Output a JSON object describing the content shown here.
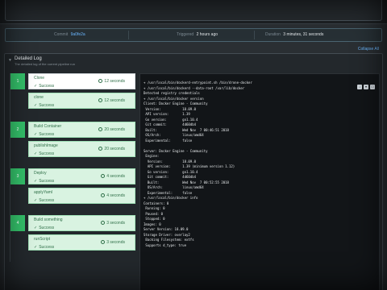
{
  "build_info": {
    "commit_label": "Commit",
    "commit_value": "9a0fe2a",
    "triggered_label": "Triggered",
    "triggered_value": "2 hours ago",
    "duration_label": "Duration",
    "duration_value": "3 minutes, 31 seconds"
  },
  "collapse_all": "Collapse All",
  "panel": {
    "title": "Detailed Log",
    "subtitle": "The detailed log of the current pipeline run"
  },
  "groups": [
    {
      "number": "1",
      "steps": [
        {
          "name": "Clone",
          "status": "Success",
          "duration": "12 seconds",
          "active": true
        },
        {
          "name": "clone",
          "status": "Success",
          "duration": "12 seconds",
          "active": false
        }
      ]
    },
    {
      "number": "2",
      "steps": [
        {
          "name": "Build Container",
          "status": "Success",
          "duration": "20 seconds",
          "active": false
        },
        {
          "name": "publishImage",
          "status": "Success",
          "duration": "20 seconds",
          "active": false
        }
      ]
    },
    {
      "number": "3",
      "steps": [
        {
          "name": "Deploy",
          "status": "Success",
          "duration": "4 seconds",
          "active": false
        },
        {
          "name": "applyYaml",
          "status": "Success",
          "duration": "4 seconds",
          "active": false
        }
      ]
    },
    {
      "number": "4",
      "steps": [
        {
          "name": "Build something",
          "status": "Success",
          "duration": "3 seconds",
          "active": false
        },
        {
          "name": "runScript",
          "status": "Success",
          "duration": "3 seconds",
          "active": false
        }
      ]
    }
  ],
  "log_lines": [
    "+ /usr/local/bin/dockerd-entrypoint.sh /bin/drone-docker",
    "+ /usr/local/bin/dockerd --data-root /var/lib/docker",
    "Detected registry credentials",
    "+ /usr/local/bin/docker version",
    "Client: Docker Engine - Community",
    " Version:           18.09.0",
    " API version:       1.39",
    " Go version:        go1.10.4",
    " Git commit:        4d60db4",
    " Built:             Wed Nov  7 00:46:51 2018",
    " OS/Arch:           linux/amd64",
    " Experimental:      false",
    "",
    "Server: Docker Engine - Community",
    " Engine:",
    "  Version:          18.09.0",
    "  API version:      1.39 (minimum version 1.12)",
    "  Go version:       go1.10.4",
    "  Git commit:       4d60db4",
    "  Built:            Wed Nov  7 00:52:55 2018",
    "  OS/Arch:          linux/amd64",
    "  Experimental:     false",
    "+ /usr/local/bin/docker info",
    "Containers: 0",
    " Running: 0",
    " Paused: 0",
    " Stopped: 0",
    "Images: 0",
    "Server Version: 18.09.0",
    "Storage Driver: overlay2",
    " Backing Filesystem: extfs",
    " Supports d_type: true"
  ]
}
